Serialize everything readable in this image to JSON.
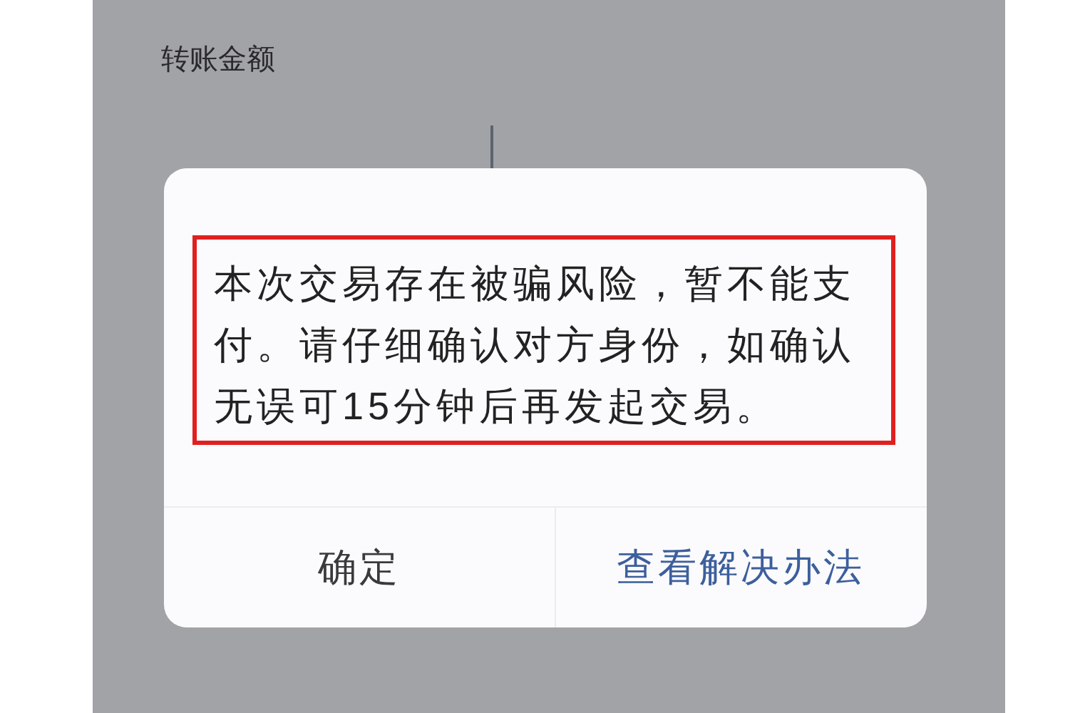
{
  "screen": {
    "field_label": "转账金额"
  },
  "dialog": {
    "message": "本次交易存在被骗风险，暂不能支付。请仔细确认对方身份，如确认无误可15分钟后再发起交易。",
    "buttons": [
      {
        "label": "确定",
        "kind": "default"
      },
      {
        "label": "查看解决办法",
        "kind": "primary"
      }
    ]
  }
}
